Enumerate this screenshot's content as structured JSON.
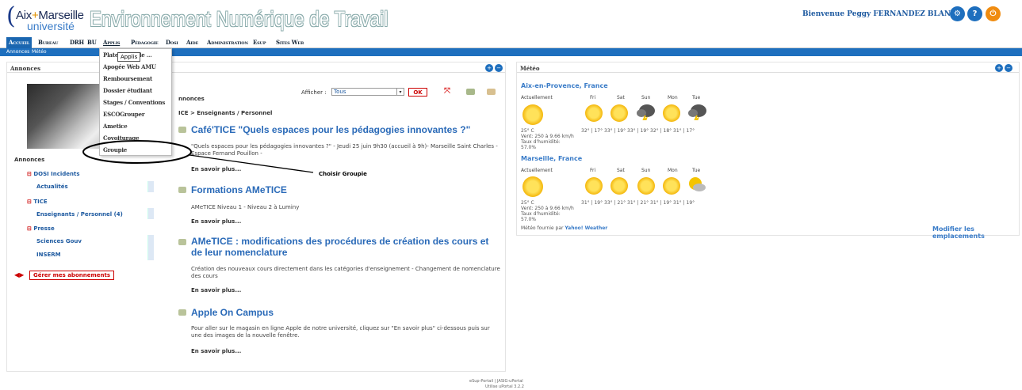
{
  "header": {
    "logo_line1a": "Aix",
    "logo_plus": "+",
    "logo_line1b": "Marseille",
    "logo_line2": "université",
    "title": "Environnement Numérique de Travail",
    "welcome": "Bienvenue Peggy FERNANDEZ BLANCO."
  },
  "nav": {
    "items": [
      "Accueil",
      "Bureau",
      "DRH",
      "BU",
      "Applis",
      "Pédagogie",
      "Dosi",
      "Aide",
      "Administration",
      "Esup",
      "Sites Web"
    ]
  },
  "subnav": {
    "items": [
      "Annonces",
      "Météo"
    ]
  },
  "dropdown": {
    "tooltip": "Applis",
    "items": [
      "Plateforme de ...",
      "Apogée Web AMU",
      "Remboursement",
      "Dossier étudiant",
      "Stages / Conventions",
      "ESCOGrouper",
      "Ametice",
      "Covoiturage",
      "Groupie"
    ],
    "item0_suffix": "c"
  },
  "annotation": {
    "text": "Choisir Groupie"
  },
  "annonces_panel": {
    "title": "Annonces",
    "afficher_label": "Afficher :",
    "afficher_value": "Tous",
    "ok_label": "OK",
    "section_label": "nnonces",
    "breadcrumb": "ICE > Enseignants / Personnel",
    "sidebar_title": "Annonces",
    "sidebar": [
      {
        "head": "DOSI Incidents",
        "items": [
          "Actualités"
        ]
      },
      {
        "head": "TICE",
        "items": [
          "Enseignants / Personnel (4)"
        ]
      },
      {
        "head": "Presse",
        "items": [
          "Sciences Gouv",
          "INSERM"
        ]
      }
    ],
    "manage_label": "Gérer mes abonnements",
    "articles": [
      {
        "title": "Café'TICE \"Quels espaces pour les pédagogies innovantes ?\"",
        "text": "\"Quels espaces pour les pédagogies innovantes ?\" - Jeudi 25 juin 9h30 (accueil à 9h)- Marseille Saint Charles - Espace Fernand Pouillon -",
        "more": "En savoir plus..."
      },
      {
        "title": "Formations AMeTICE",
        "text": "AMeTICE Niveau 1 - Niveau 2 à Luminy",
        "more": "En savoir plus..."
      },
      {
        "title": "AMeTICE : modifications des procédures de création des cours et de leur nomenclature",
        "text": "Création des nouveaux cours directement dans les catégories d'enseignement - Changement de nomenclature des cours",
        "more": "En savoir plus..."
      },
      {
        "title": "Apple On Campus",
        "text": "Pour aller sur le magasin en ligne Apple de notre université, cliquez sur \"En savoir plus\" ci-dessous puis sur une des images de la nouvelle fenêtre.",
        "more": "En savoir plus..."
      }
    ]
  },
  "meteo_panel": {
    "title": "Météo",
    "cities": [
      {
        "name": "Aix-en-Provence, France",
        "current_label": "Actuellement",
        "days": [
          "Fri",
          "Sat",
          "Sun",
          "Mon",
          "Tue"
        ],
        "temps": "32° | 17° 33° | 19° 33° | 19° 32° | 18° 31° | 17°",
        "current": "25° C",
        "wind": "Vent: 250 à 9.66 km/h",
        "humidity_label": "Taux d'humidité:",
        "humidity": "57.0%"
      },
      {
        "name": "Marseille, France",
        "current_label": "Actuellement",
        "days": [
          "Fri",
          "Sat",
          "Sun",
          "Mon",
          "Tue"
        ],
        "temps": "31° | 19° 33° | 21° 31° | 21° 31° | 19° 31° | 19°",
        "current": "25° C",
        "wind": "Vent: 250 à 9.66 km/h",
        "humidity_label": "Taux d'humidité:",
        "humidity": "57.0%"
      }
    ],
    "provider_prefix": "Météo fournie par",
    "provider": "Yahoo! Weather",
    "modify_label": "Modifier les emplacements"
  },
  "footer": {
    "line1": "eSup-Portail | JASIG-uPortal",
    "line2": "Utilise uPortal 3.2.2"
  },
  "colors": {
    "nav_active": "#1a66b0",
    "subnav": "#1e6fbe",
    "link": "#1e5aa0",
    "article_title": "#2a6ab8"
  }
}
